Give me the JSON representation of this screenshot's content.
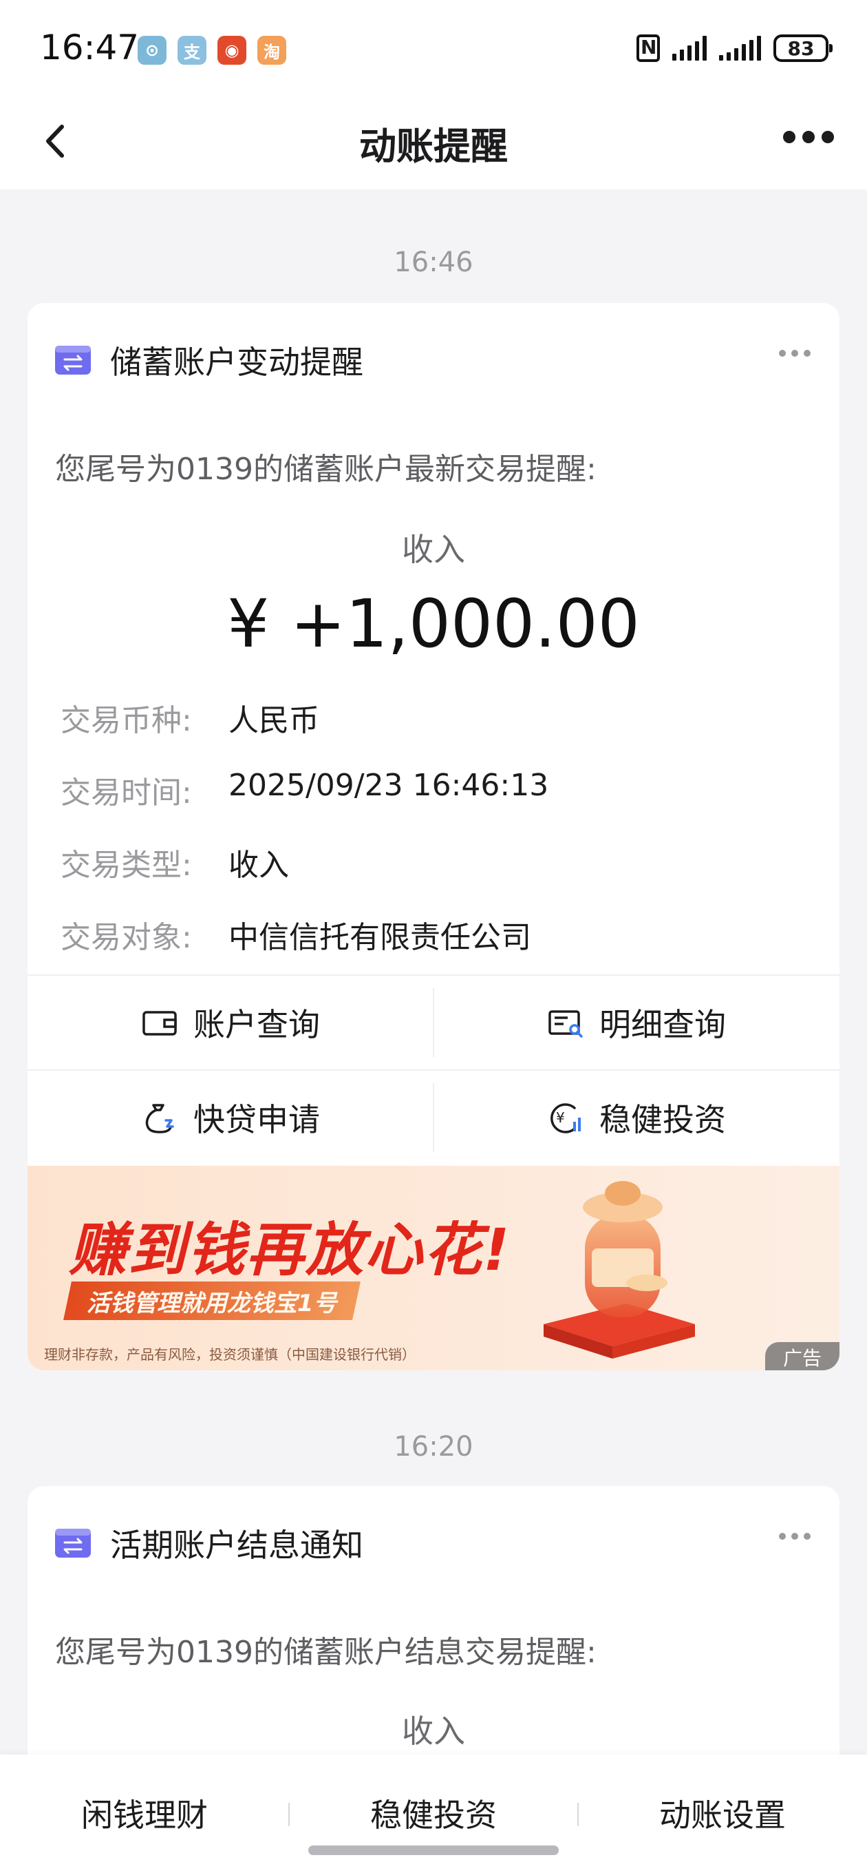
{
  "status_bar": {
    "time": "16:47",
    "app_badges": [
      {
        "glyph": "⊙",
        "color": "#7eb8d8",
        "name": "camera-app-icon"
      },
      {
        "glyph": "支",
        "color": "#8cc0e0",
        "name": "alipay-app-icon"
      },
      {
        "glyph": "◉",
        "color": "#e24a2c",
        "name": "weibo-app-icon"
      },
      {
        "glyph": "淘",
        "color": "#f3a05a",
        "name": "taobao-app-icon"
      }
    ],
    "battery": "83"
  },
  "nav": {
    "title": "动账提醒"
  },
  "messages": [
    {
      "time": "16:46",
      "title": "储蓄账户变动提醒",
      "intro": "您尾号为0139的储蓄账户最新交易提醒:",
      "direction": "收入",
      "amount": "¥ +1,000.00",
      "details": [
        {
          "label": "交易币种:",
          "value": "人民币"
        },
        {
          "label": "交易时间:",
          "value": "2025/09/23 16:46:13"
        },
        {
          "label": "交易类型:",
          "value": "收入"
        },
        {
          "label": "交易对象:",
          "value": "中信信托有限责任公司"
        }
      ],
      "actions": [
        {
          "label": "账户查询"
        },
        {
          "label": "明细查询"
        },
        {
          "label": "快贷申请"
        },
        {
          "label": "稳健投资"
        }
      ],
      "ad": {
        "headline": "赚到钱再放心花!",
        "sub": "活钱管理就用龙钱宝1号",
        "disclaimer": "理财非存款，产品有风险，投资须谨慎（中国建设银行代销）",
        "tag": "广告"
      }
    },
    {
      "time": "16:20",
      "title": "活期账户结息通知",
      "intro": "您尾号为0139的储蓄账户结息交易提醒:",
      "direction": "收入"
    }
  ],
  "bottom_tabs": [
    {
      "label": "闲钱理财"
    },
    {
      "label": "稳健投资"
    },
    {
      "label": "动账设置"
    }
  ],
  "colors": {
    "accent_purple": "#6f6cf0",
    "ad_red": "#e2261a"
  }
}
